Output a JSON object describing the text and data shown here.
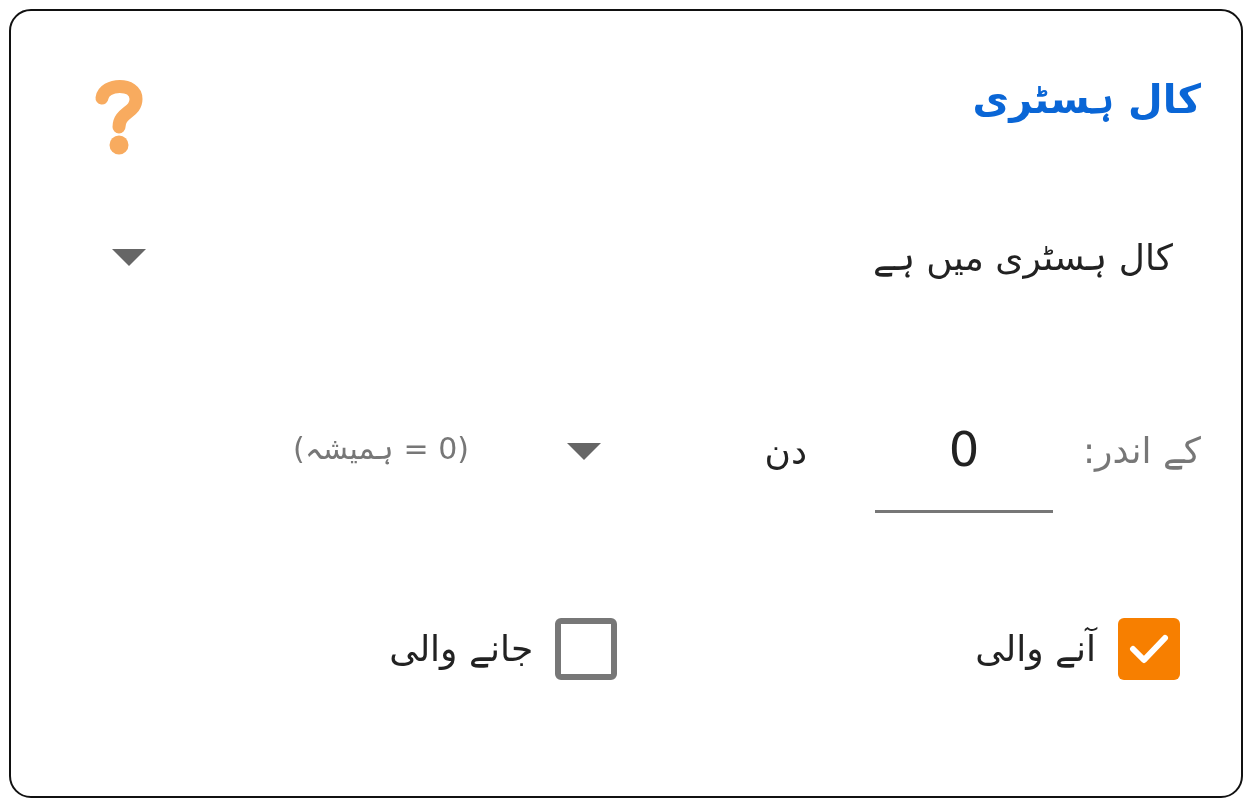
{
  "block": {
    "title": "کال ہسٹری"
  },
  "condition": {
    "value": "کال ہسٹری میں ہے"
  },
  "period": {
    "label": "کے اندر:",
    "days": "0",
    "unit": "دن",
    "hint": "(0 = ہمیشہ)"
  },
  "directions": [
    {
      "label": "آنے والی",
      "checked": true
    },
    {
      "label": "جانے والی",
      "checked": false
    }
  ]
}
